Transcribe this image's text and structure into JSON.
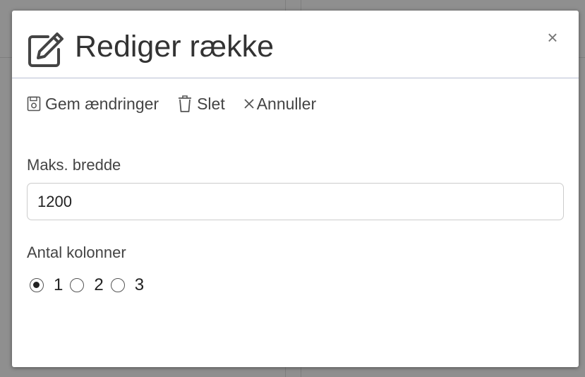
{
  "dialog": {
    "title": "Rediger række",
    "close_label": "×"
  },
  "toolbar": {
    "save_label": "Gem ændringer",
    "delete_label": "Slet",
    "cancel_label": "Annuller"
  },
  "form": {
    "max_width": {
      "label": "Maks. bredde",
      "value": "1200"
    },
    "columns": {
      "label": "Antal kolonner",
      "options": [
        "1",
        "2",
        "3"
      ],
      "selected": "1"
    }
  },
  "icons": {
    "title": "edit-icon",
    "save": "save-icon",
    "delete": "trash-icon",
    "cancel": "close-icon"
  },
  "colors": {
    "backdrop": "#8f8f8f",
    "header_divider": "#b9bfd3",
    "text": "#333333"
  }
}
